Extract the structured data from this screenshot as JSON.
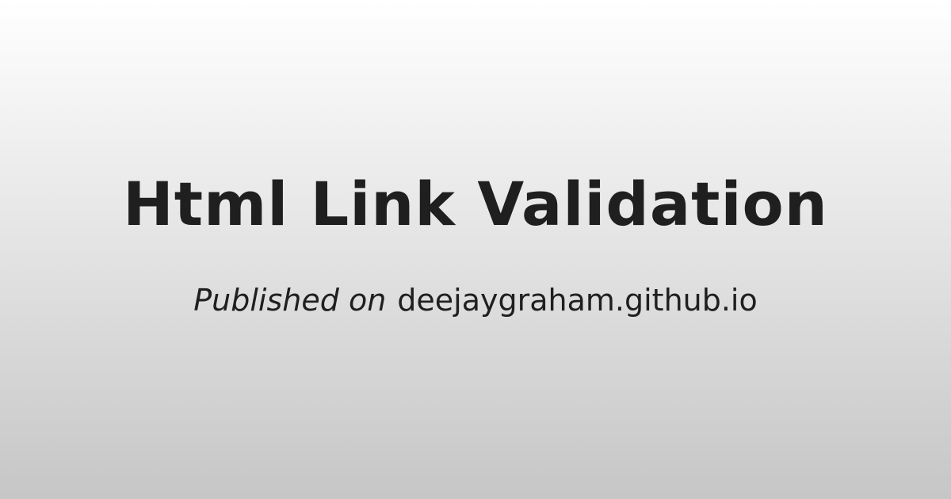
{
  "card": {
    "title": "Html Link Validation",
    "byline_prefix": "Published on",
    "site": "deejaygraham.github.io"
  },
  "colors": {
    "text": "#1f1f1f",
    "background_top": "#ffffff",
    "background_bottom": "#c6c6c6"
  }
}
